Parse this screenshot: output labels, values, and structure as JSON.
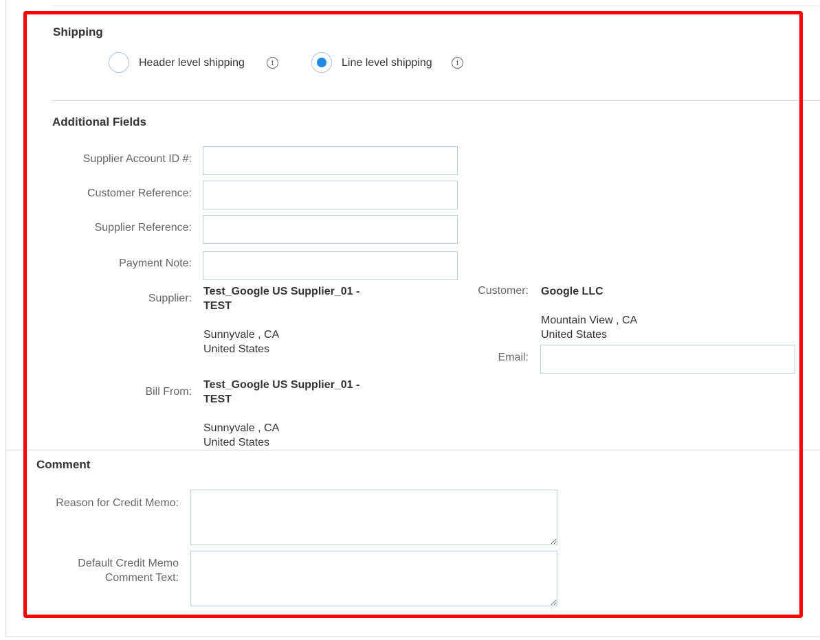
{
  "shipping": {
    "title": "Shipping",
    "options": [
      {
        "label": "Header level shipping",
        "selected": false
      },
      {
        "label": "Line level shipping",
        "selected": true
      }
    ]
  },
  "additional_fields": {
    "title": "Additional Fields",
    "supplier_account_label": "Supplier Account ID #:",
    "supplier_account_value": "",
    "customer_reference_label": "Customer Reference:",
    "customer_reference_value": "",
    "supplier_reference_label": "Supplier Reference:",
    "supplier_reference_value": "",
    "payment_note_label": "Payment Note:",
    "payment_note_value": "",
    "supplier": {
      "label": "Supplier:",
      "name_line1": "Test_Google US Supplier_01 -",
      "name_line2": "TEST",
      "city": "Sunnyvale , CA",
      "country": "United States"
    },
    "bill_from": {
      "label": "Bill From:",
      "name_line1": "Test_Google US Supplier_01 -",
      "name_line2": "TEST",
      "city": "Sunnyvale , CA",
      "country": "United States"
    },
    "customer": {
      "label": "Customer:",
      "name": "Google LLC",
      "city": "Mountain View , CA",
      "country": "United States"
    },
    "email_label": "Email:",
    "email_value": ""
  },
  "comment": {
    "title": "Comment",
    "reason_label": "Reason for Credit Memo:",
    "reason_value": "",
    "default_text_label_line1": "Default Credit Memo",
    "default_text_label_line2": "Comment Text:",
    "default_text_value": ""
  },
  "colors": {
    "highlight": "#ff0000",
    "radio_selected": "#1e88e5",
    "input_border": "#b6cfe0"
  }
}
